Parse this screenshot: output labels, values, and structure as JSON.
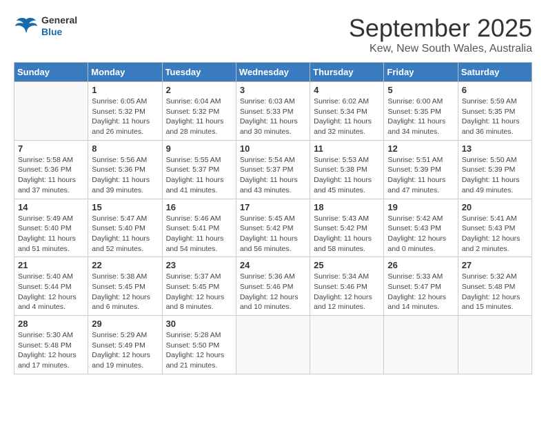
{
  "header": {
    "logo_line1": "General",
    "logo_line2": "Blue",
    "month": "September 2025",
    "location": "Kew, New South Wales, Australia"
  },
  "weekdays": [
    "Sunday",
    "Monday",
    "Tuesday",
    "Wednesday",
    "Thursday",
    "Friday",
    "Saturday"
  ],
  "weeks": [
    [
      {
        "day": "",
        "info": ""
      },
      {
        "day": "1",
        "info": "Sunrise: 6:05 AM\nSunset: 5:32 PM\nDaylight: 11 hours\nand 26 minutes."
      },
      {
        "day": "2",
        "info": "Sunrise: 6:04 AM\nSunset: 5:32 PM\nDaylight: 11 hours\nand 28 minutes."
      },
      {
        "day": "3",
        "info": "Sunrise: 6:03 AM\nSunset: 5:33 PM\nDaylight: 11 hours\nand 30 minutes."
      },
      {
        "day": "4",
        "info": "Sunrise: 6:02 AM\nSunset: 5:34 PM\nDaylight: 11 hours\nand 32 minutes."
      },
      {
        "day": "5",
        "info": "Sunrise: 6:00 AM\nSunset: 5:35 PM\nDaylight: 11 hours\nand 34 minutes."
      },
      {
        "day": "6",
        "info": "Sunrise: 5:59 AM\nSunset: 5:35 PM\nDaylight: 11 hours\nand 36 minutes."
      }
    ],
    [
      {
        "day": "7",
        "info": "Sunrise: 5:58 AM\nSunset: 5:36 PM\nDaylight: 11 hours\nand 37 minutes."
      },
      {
        "day": "8",
        "info": "Sunrise: 5:56 AM\nSunset: 5:36 PM\nDaylight: 11 hours\nand 39 minutes."
      },
      {
        "day": "9",
        "info": "Sunrise: 5:55 AM\nSunset: 5:37 PM\nDaylight: 11 hours\nand 41 minutes."
      },
      {
        "day": "10",
        "info": "Sunrise: 5:54 AM\nSunset: 5:37 PM\nDaylight: 11 hours\nand 43 minutes."
      },
      {
        "day": "11",
        "info": "Sunrise: 5:53 AM\nSunset: 5:38 PM\nDaylight: 11 hours\nand 45 minutes."
      },
      {
        "day": "12",
        "info": "Sunrise: 5:51 AM\nSunset: 5:39 PM\nDaylight: 11 hours\nand 47 minutes."
      },
      {
        "day": "13",
        "info": "Sunrise: 5:50 AM\nSunset: 5:39 PM\nDaylight: 11 hours\nand 49 minutes."
      }
    ],
    [
      {
        "day": "14",
        "info": "Sunrise: 5:49 AM\nSunset: 5:40 PM\nDaylight: 11 hours\nand 51 minutes."
      },
      {
        "day": "15",
        "info": "Sunrise: 5:47 AM\nSunset: 5:40 PM\nDaylight: 11 hours\nand 52 minutes."
      },
      {
        "day": "16",
        "info": "Sunrise: 5:46 AM\nSunset: 5:41 PM\nDaylight: 11 hours\nand 54 minutes."
      },
      {
        "day": "17",
        "info": "Sunrise: 5:45 AM\nSunset: 5:42 PM\nDaylight: 11 hours\nand 56 minutes."
      },
      {
        "day": "18",
        "info": "Sunrise: 5:43 AM\nSunset: 5:42 PM\nDaylight: 11 hours\nand 58 minutes."
      },
      {
        "day": "19",
        "info": "Sunrise: 5:42 AM\nSunset: 5:43 PM\nDaylight: 12 hours\nand 0 minutes."
      },
      {
        "day": "20",
        "info": "Sunrise: 5:41 AM\nSunset: 5:43 PM\nDaylight: 12 hours\nand 2 minutes."
      }
    ],
    [
      {
        "day": "21",
        "info": "Sunrise: 5:40 AM\nSunset: 5:44 PM\nDaylight: 12 hours\nand 4 minutes."
      },
      {
        "day": "22",
        "info": "Sunrise: 5:38 AM\nSunset: 5:45 PM\nDaylight: 12 hours\nand 6 minutes."
      },
      {
        "day": "23",
        "info": "Sunrise: 5:37 AM\nSunset: 5:45 PM\nDaylight: 12 hours\nand 8 minutes."
      },
      {
        "day": "24",
        "info": "Sunrise: 5:36 AM\nSunset: 5:46 PM\nDaylight: 12 hours\nand 10 minutes."
      },
      {
        "day": "25",
        "info": "Sunrise: 5:34 AM\nSunset: 5:46 PM\nDaylight: 12 hours\nand 12 minutes."
      },
      {
        "day": "26",
        "info": "Sunrise: 5:33 AM\nSunset: 5:47 PM\nDaylight: 12 hours\nand 14 minutes."
      },
      {
        "day": "27",
        "info": "Sunrise: 5:32 AM\nSunset: 5:48 PM\nDaylight: 12 hours\nand 15 minutes."
      }
    ],
    [
      {
        "day": "28",
        "info": "Sunrise: 5:30 AM\nSunset: 5:48 PM\nDaylight: 12 hours\nand 17 minutes."
      },
      {
        "day": "29",
        "info": "Sunrise: 5:29 AM\nSunset: 5:49 PM\nDaylight: 12 hours\nand 19 minutes."
      },
      {
        "day": "30",
        "info": "Sunrise: 5:28 AM\nSunset: 5:50 PM\nDaylight: 12 hours\nand 21 minutes."
      },
      {
        "day": "",
        "info": ""
      },
      {
        "day": "",
        "info": ""
      },
      {
        "day": "",
        "info": ""
      },
      {
        "day": "",
        "info": ""
      }
    ]
  ]
}
